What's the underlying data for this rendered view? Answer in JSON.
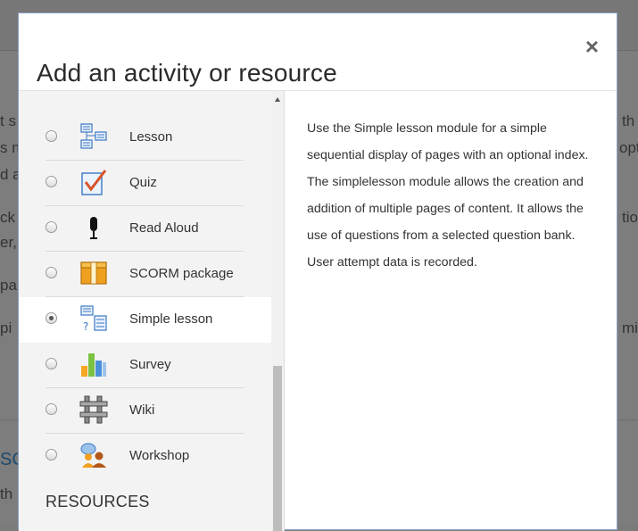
{
  "background": {
    "fragments": [
      "t s",
      "s m",
      "d a",
      "ck",
      "er,",
      "pa",
      "pi",
      "th",
      "opt",
      "tio",
      "mit",
      "SC",
      "th"
    ]
  },
  "modal": {
    "title": "Add an activity or resource",
    "close_symbol": "×"
  },
  "options": [
    {
      "label": "Lesson",
      "icon": "lesson-icon",
      "selected": false
    },
    {
      "label": "Quiz",
      "icon": "quiz-icon",
      "selected": false
    },
    {
      "label": "Read Aloud",
      "icon": "microphone-icon",
      "selected": false
    },
    {
      "label": "SCORM package",
      "icon": "scorm-package-icon",
      "selected": false
    },
    {
      "label": "Simple lesson",
      "icon": "simple-lesson-icon",
      "selected": true
    },
    {
      "label": "Survey",
      "icon": "survey-chart-icon",
      "selected": false
    },
    {
      "label": "Wiki",
      "icon": "wiki-icon",
      "selected": false
    },
    {
      "label": "Workshop",
      "icon": "workshop-icon",
      "selected": false
    }
  ],
  "resources_heading": "RESOURCES",
  "summary": "Use the Simple lesson module for a simple sequential display of pages with an optional index. The simplelesson module allows the creation and addition of multiple pages of content. It allows the use of questions from a selected question bank. User attempt data is recorded.",
  "colors": {
    "overlay": "#7d7d7d",
    "modal_border": "#8aa1c9",
    "selected_row": "#ffffff",
    "pane_bg": "#f3f3f3"
  }
}
